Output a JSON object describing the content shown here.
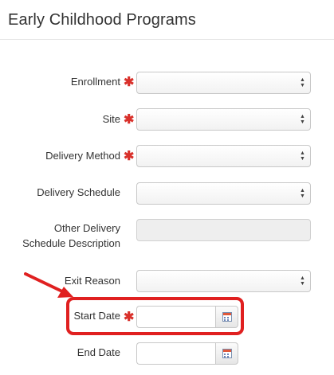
{
  "page": {
    "title": "Early Childhood Programs"
  },
  "form": {
    "fields": [
      {
        "label": "Enrollment",
        "required": true,
        "type": "select"
      },
      {
        "label": "Site",
        "required": true,
        "type": "select"
      },
      {
        "label": "Delivery Method",
        "required": true,
        "type": "select"
      },
      {
        "label": "Delivery Schedule",
        "required": false,
        "type": "select"
      },
      {
        "label": "Other Delivery Schedule Description",
        "required": false,
        "type": "text-disabled"
      },
      {
        "label": "Exit Reason",
        "required": false,
        "type": "select"
      },
      {
        "label": "Start Date",
        "required": true,
        "type": "date",
        "value": ""
      },
      {
        "label": "End Date",
        "required": false,
        "type": "date",
        "value": ""
      }
    ],
    "required_mark": "✱"
  },
  "annotation": {
    "highlight_color": "#e02020",
    "target_field": "Start Date"
  },
  "colors": {
    "required": "#d9312b",
    "disabled_bg": "#eeeeee"
  },
  "icons": {
    "select": "updown-arrows-icon",
    "calendar": "calendar-icon"
  }
}
